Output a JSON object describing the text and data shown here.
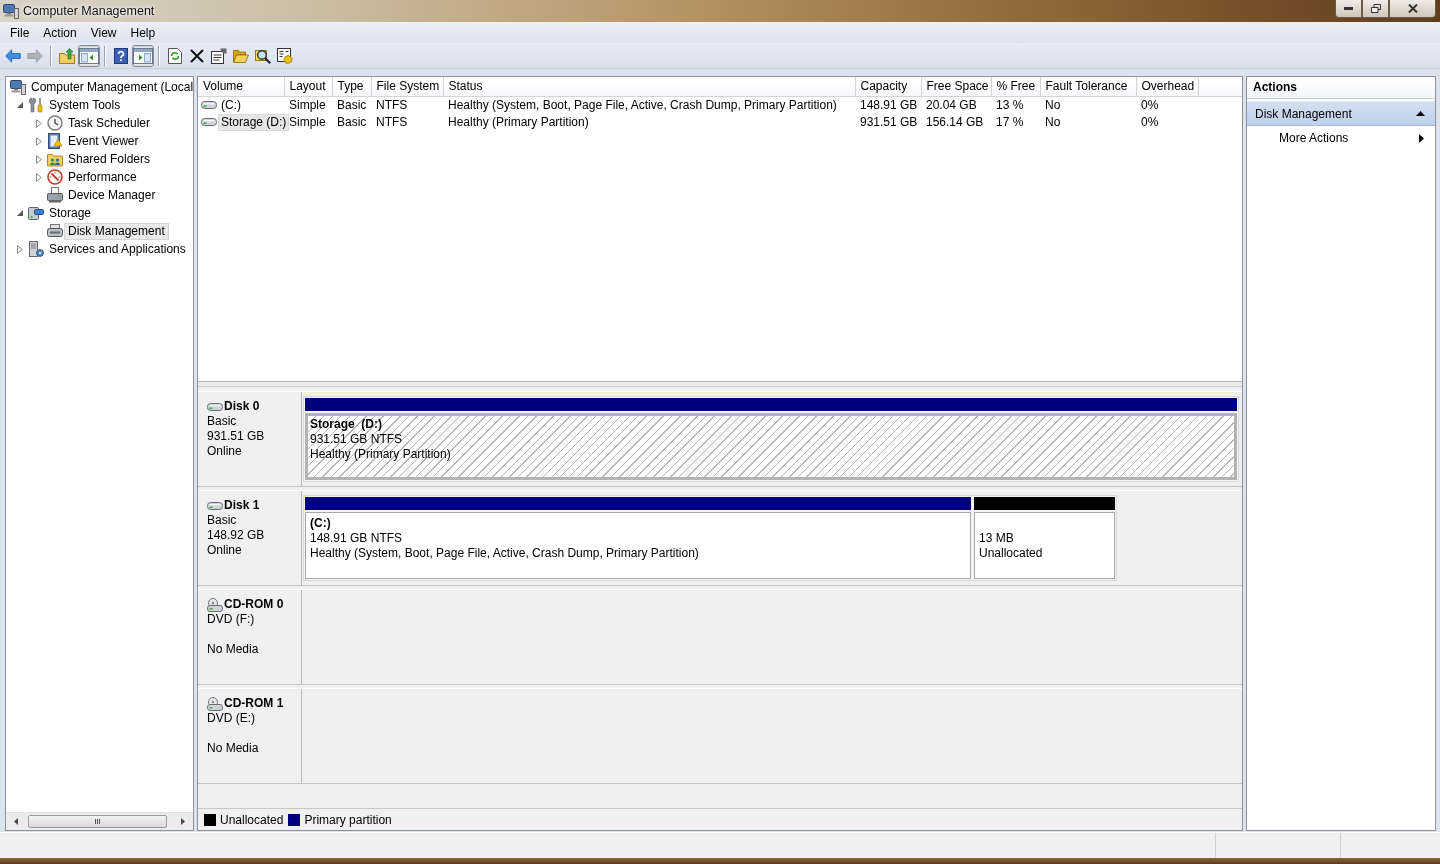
{
  "window": {
    "title": "Computer Management"
  },
  "menu": [
    "File",
    "Action",
    "View",
    "Help"
  ],
  "toolbar": [
    {
      "pressed": false,
      "disabled": false
    },
    {
      "pressed": false,
      "disabled": true
    },
    {
      "pressed": false,
      "disabled": false
    },
    {
      "pressed": true,
      "disabled": false
    },
    {
      "pressed": false,
      "disabled": false
    },
    {
      "pressed": true,
      "disabled": false
    },
    {
      "pressed": false,
      "disabled": false
    },
    {
      "pressed": false,
      "disabled": false
    },
    {
      "pressed": false,
      "disabled": false
    },
    {
      "pressed": false,
      "disabled": false
    },
    {
      "pressed": false,
      "disabled": false
    },
    {
      "pressed": false,
      "disabled": false
    }
  ],
  "tree": [
    {
      "label": "Computer Management (Local",
      "selected": false,
      "children": [
        {
          "label": "System Tools",
          "expanded": true,
          "selected": false,
          "children": [
            {
              "label": "Task Scheduler",
              "expanded": false,
              "selected": false
            },
            {
              "label": "Event Viewer",
              "expanded": false,
              "selected": false
            },
            {
              "label": "Shared Folders",
              "expanded": false,
              "selected": false
            },
            {
              "label": "Performance",
              "expanded": false,
              "selected": false
            },
            {
              "label": "Device Manager",
              "selected": false
            }
          ]
        },
        {
          "label": "Storage",
          "expanded": true,
          "selected": false,
          "children": [
            {
              "label": "Disk Management",
              "selected": true
            }
          ]
        },
        {
          "label": "Services and Applications",
          "expanded": false,
          "selected": false
        }
      ]
    }
  ],
  "volumes": {
    "columns": [
      "Volume",
      "Layout",
      "Type",
      "File System",
      "Status",
      "Capacity",
      "Free Space",
      "% Free",
      "Fault Tolerance",
      "Overhead"
    ],
    "rows": [
      {
        "selected": false,
        "cells": [
          "(C:)",
          "Simple",
          "Basic",
          "NTFS",
          "Healthy (System, Boot, Page File, Active, Crash Dump, Primary Partition)",
          "148.91 GB",
          "20.04 GB",
          "13 %",
          "No",
          "0%"
        ]
      },
      {
        "selected": true,
        "cells": [
          "Storage (D:)",
          "Simple",
          "Basic",
          "NTFS",
          "Healthy (Primary Partition)",
          "931.51 GB",
          "156.14 GB",
          "17 %",
          "No",
          "0%"
        ]
      }
    ]
  },
  "disks": [
    {
      "kind": "disk",
      "name": "Disk 0",
      "type": "Basic",
      "size": "931.51 GB",
      "status": "Online",
      "partitions": [
        {
          "name": "Storage  (D:)",
          "size": "931.51 GB NTFS",
          "status": "Healthy (Primary Partition)",
          "color": "#000080",
          "selected": true
        }
      ]
    },
    {
      "kind": "disk",
      "name": "Disk 1",
      "type": "Basic",
      "size": "148.92 GB",
      "status": "Online",
      "partitions": [
        {
          "name": "(C:)",
          "size": "148.91 GB NTFS",
          "status": "Healthy (System, Boot, Page File, Active, Crash Dump, Primary Partition)",
          "color": "#000080",
          "selected": false
        },
        {
          "size": "13 MB",
          "status": "Unallocated",
          "color": "#000000",
          "selected": false
        }
      ]
    },
    {
      "kind": "cdrom",
      "name": "CD-ROM 0",
      "type": "DVD (F:)",
      "status": "No Media"
    },
    {
      "kind": "cdrom",
      "name": "CD-ROM 1",
      "type": "DVD (E:)",
      "status": "No Media"
    }
  ],
  "legend": [
    {
      "label": "Unallocated",
      "color": "#000000"
    },
    {
      "label": "Primary partition",
      "color": "#000080"
    }
  ],
  "actions": {
    "title": "Actions",
    "sections": [
      {
        "label": "Disk Management",
        "expanded": true,
        "items": [
          {
            "label": "More Actions",
            "submenu": true
          }
        ]
      }
    ]
  }
}
